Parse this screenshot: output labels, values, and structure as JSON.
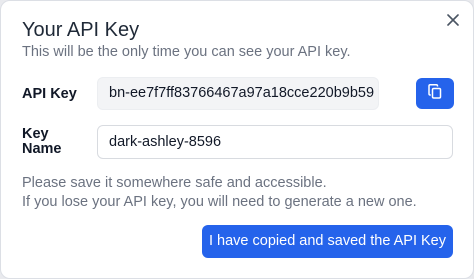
{
  "dialog": {
    "title": "Your API Key",
    "subtitle": "This will be the only time you can see your API key."
  },
  "fields": {
    "api_key": {
      "label": "API Key",
      "value": "bn-ee7f7ff83766467a97a18cce220b9b59"
    },
    "key_name": {
      "label": "Key Name",
      "value": "dark-ashley-8596"
    }
  },
  "notes": {
    "line1": "Please save it somewhere safe and accessible.",
    "line2": "If you lose your API key, you will need to generate a new one."
  },
  "buttons": {
    "confirm_label": "I have copied and saved the API Key",
    "copy_icon": "copy-icon",
    "close_icon": "close-icon"
  },
  "colors": {
    "accent": "#2563eb",
    "muted_text": "#6b7280",
    "title_text": "#1f2937"
  }
}
